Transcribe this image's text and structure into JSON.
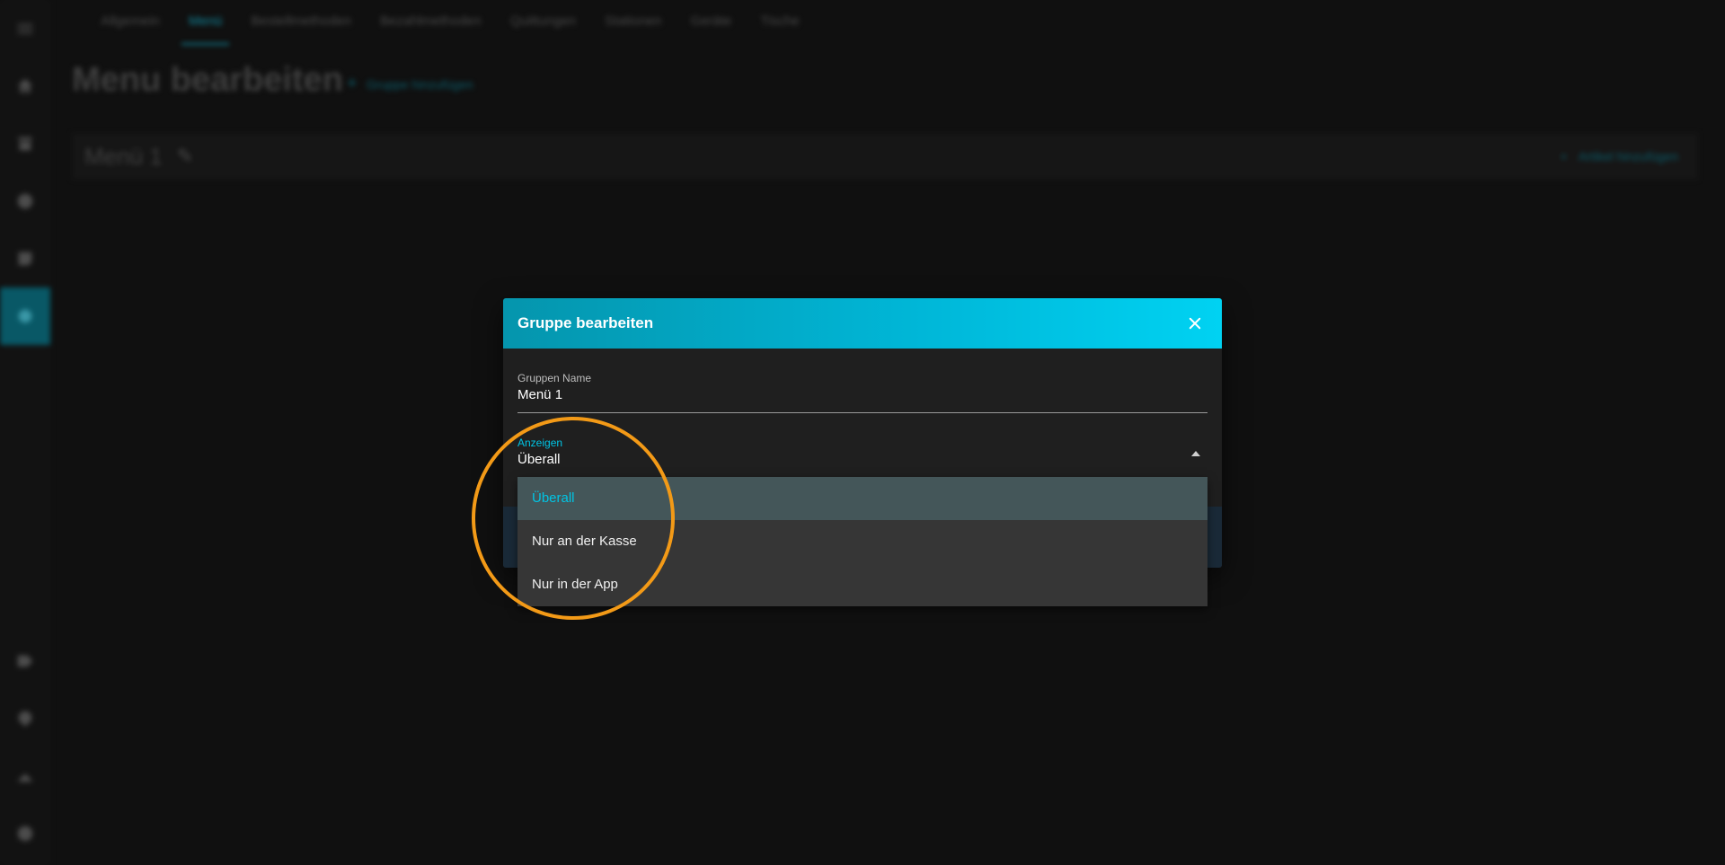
{
  "top_nav": {
    "tabs": [
      {
        "label": "Allgemein",
        "active": false
      },
      {
        "label": "Menü",
        "active": true
      },
      {
        "label": "Bestellmethoden",
        "active": false
      },
      {
        "label": "Bezahlmethoden",
        "active": false
      },
      {
        "label": "Quittungen",
        "active": false
      },
      {
        "label": "Stationen",
        "active": false
      },
      {
        "label": "Geräte",
        "active": false
      },
      {
        "label": "Tische",
        "active": false
      }
    ]
  },
  "page": {
    "title": "Menu bearbeiten",
    "add_group_label": "Gruppe hinzufügen",
    "menu_name": "Menü 1",
    "add_item_label": "Artikel hinzufügen"
  },
  "dialog": {
    "title": "Gruppe bearbeiten",
    "group_name_label": "Gruppen Name",
    "group_name_value": "Menü 1",
    "display_label": "Anzeigen",
    "display_value": "Überall",
    "options": [
      {
        "label": "Überall",
        "selected": true
      },
      {
        "label": "Nur an der Kasse",
        "selected": false
      },
      {
        "label": "Nur in der App",
        "selected": false
      }
    ]
  },
  "colors": {
    "accent": "#00c4e4",
    "header_gradient_start": "#0595ad",
    "header_gradient_end": "#00d2f2",
    "annotation_ring": "#f39a17",
    "background": "#141414"
  },
  "icons": {
    "sidebar": [
      "menu-icon",
      "home-icon",
      "store-icon",
      "clock-icon",
      "receipt-icon",
      "settings-icon",
      "tag-icon",
      "support-icon",
      "account-icon",
      "help-icon"
    ],
    "close": "close-icon",
    "dropdown_caret": "caret-up-icon",
    "edit": "pencil-icon",
    "add": "plus-icon"
  }
}
